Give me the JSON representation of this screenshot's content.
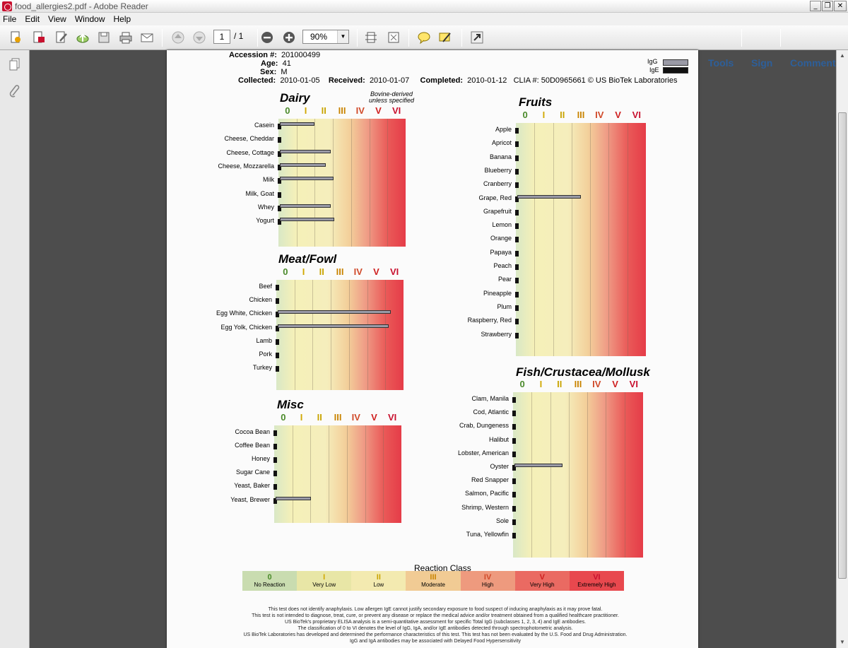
{
  "window": {
    "title": "food_allergies2.pdf - Adobe Reader",
    "min": "_",
    "restore": "❐",
    "close": "✕"
  },
  "menu": [
    "File",
    "Edit",
    "View",
    "Window",
    "Help"
  ],
  "toolbar": {
    "page_current": "1",
    "page_total": "/ 1",
    "zoom": "90%",
    "tools": "Tools",
    "sign": "Sign",
    "comment": "Comment"
  },
  "doc": {
    "accession_label": "Accession #:",
    "accession": "201000499",
    "age_label": "Age:",
    "age": "41",
    "sex_label": "Sex:",
    "sex": "M",
    "collected_label": "Collected:",
    "collected": "2010-01-05",
    "received_label": "Received:",
    "received": "2010-01-07",
    "completed_label": "Completed:",
    "completed": "2010-01-12",
    "clia": "CLIA #: 50D0965661 © US BioTek Laboratories",
    "legend_igg": "IgG",
    "legend_ige": "IgE",
    "bovine_note": "Bovine-derived unless specified"
  },
  "classes": [
    "0",
    "I",
    "II",
    "III",
    "IV",
    "V",
    "VI"
  ],
  "class_colors": [
    "#4a8a2a",
    "#d1a800",
    "#c9a400",
    "#c98400",
    "#d04a2a",
    "#cf2020",
    "#c8102e"
  ],
  "panels": [
    {
      "id": "dairy",
      "title": "Dairy",
      "items": [
        {
          "label": "Casein",
          "igg": 0.27
        },
        {
          "label": "Cheese, Cheddar",
          "igg": 0
        },
        {
          "label": "Cheese, Cottage",
          "igg": 0.4
        },
        {
          "label": "Cheese, Mozzarella",
          "igg": 0.36
        },
        {
          "label": "Milk",
          "igg": 0.42
        },
        {
          "label": "Milk, Goat",
          "igg": 0
        },
        {
          "label": "Whey",
          "igg": 0.4
        },
        {
          "label": "Yogurt",
          "igg": 0.43
        }
      ]
    },
    {
      "id": "meat",
      "title": "Meat/Fowl",
      "items": [
        {
          "label": "Beef",
          "igg": 0
        },
        {
          "label": "Chicken",
          "igg": 0
        },
        {
          "label": "Egg White, Chicken",
          "igg": 0.89
        },
        {
          "label": "Egg Yolk, Chicken",
          "igg": 0.87
        },
        {
          "label": "Lamb",
          "igg": 0
        },
        {
          "label": "Pork",
          "igg": 0
        },
        {
          "label": "Turkey",
          "igg": 0
        }
      ]
    },
    {
      "id": "misc",
      "title": "Misc",
      "items": [
        {
          "label": "Cocoa Bean",
          "igg": 0
        },
        {
          "label": "Coffee Bean",
          "igg": 0
        },
        {
          "label": "Honey",
          "igg": 0
        },
        {
          "label": "Sugar Cane",
          "igg": 0
        },
        {
          "label": "Yeast, Baker",
          "igg": 0
        },
        {
          "label": "Yeast, Brewer",
          "igg": 0.28
        }
      ]
    },
    {
      "id": "fruits",
      "title": "Fruits",
      "items": [
        {
          "label": "Apple",
          "igg": 0
        },
        {
          "label": "Apricot",
          "igg": 0
        },
        {
          "label": "Banana",
          "igg": 0
        },
        {
          "label": "Blueberry",
          "igg": 0
        },
        {
          "label": "Cranberry",
          "igg": 0
        },
        {
          "label": "Grape, Red",
          "igg": 0.49
        },
        {
          "label": "Grapefruit",
          "igg": 0
        },
        {
          "label": "Lemon",
          "igg": 0
        },
        {
          "label": "Orange",
          "igg": 0
        },
        {
          "label": "Papaya",
          "igg": 0
        },
        {
          "label": "Peach",
          "igg": 0
        },
        {
          "label": "Pear",
          "igg": 0
        },
        {
          "label": "Pineapple",
          "igg": 0
        },
        {
          "label": "Plum",
          "igg": 0
        },
        {
          "label": "Raspberry, Red",
          "igg": 0
        },
        {
          "label": "Strawberry",
          "igg": 0
        }
      ]
    },
    {
      "id": "fish",
      "title": "Fish/Crustacea/Mollusk",
      "items": [
        {
          "label": "Clam, Manila",
          "igg": 0
        },
        {
          "label": "Cod, Atlantic",
          "igg": 0
        },
        {
          "label": "Crab, Dungeness",
          "igg": 0
        },
        {
          "label": "Halibut",
          "igg": 0
        },
        {
          "label": "Lobster, American",
          "igg": 0
        },
        {
          "label": "Oyster",
          "igg": 0.37
        },
        {
          "label": "Red Snapper",
          "igg": 0
        },
        {
          "label": "Salmon, Pacific",
          "igg": 0
        },
        {
          "label": "Shrimp, Western",
          "igg": 0
        },
        {
          "label": "Sole",
          "igg": 0
        },
        {
          "label": "Tuna, Yellowfin",
          "igg": 0
        }
      ]
    }
  ],
  "reaction": {
    "title": "Reaction Class",
    "items": [
      {
        "num": "0",
        "label": "No Reaction",
        "bg": "#c9dcb0"
      },
      {
        "num": "I",
        "label": "Very Low",
        "bg": "#e8e6a6"
      },
      {
        "num": "II",
        "label": "Low",
        "bg": "#f3eab0"
      },
      {
        "num": "III",
        "label": "Moderate",
        "bg": "#f1cb94"
      },
      {
        "num": "IV",
        "label": "High",
        "bg": "#ee9a7e"
      },
      {
        "num": "V",
        "label": "Very High",
        "bg": "#ea6a62"
      },
      {
        "num": "VI",
        "label": "Extremely High",
        "bg": "#e8484e"
      }
    ]
  },
  "footer": [
    "This test does not identify anaphylaxis. Low allergen IgE cannot justify secondary exposure to food suspect of inducing anaphylaxis as it may prove fatal.",
    "This test is not intended to diagnose, treat, cure, or prevent any disease or replace the medical advice and/or treatment obtained from a qualified healthcare practitioner.",
    "US BioTek's proprietary ELISA analysis is a semi-quantitative assessment for specific Total IgG (subclasses 1, 2, 3, 4) and IgE antibodies.",
    "The classification of 0 to VI denotes the level of IgG, IgA, and/or IgE antibodies detected through spectrophotometric analysis.",
    "US BioTek Laboratories has developed and determined the performance characteristics of this test. This test has not been evaluated by the U.S. Food and Drug Administration.",
    "IgG and IgA antibodies may be associated with Delayed Food Hypersensitivity"
  ]
}
